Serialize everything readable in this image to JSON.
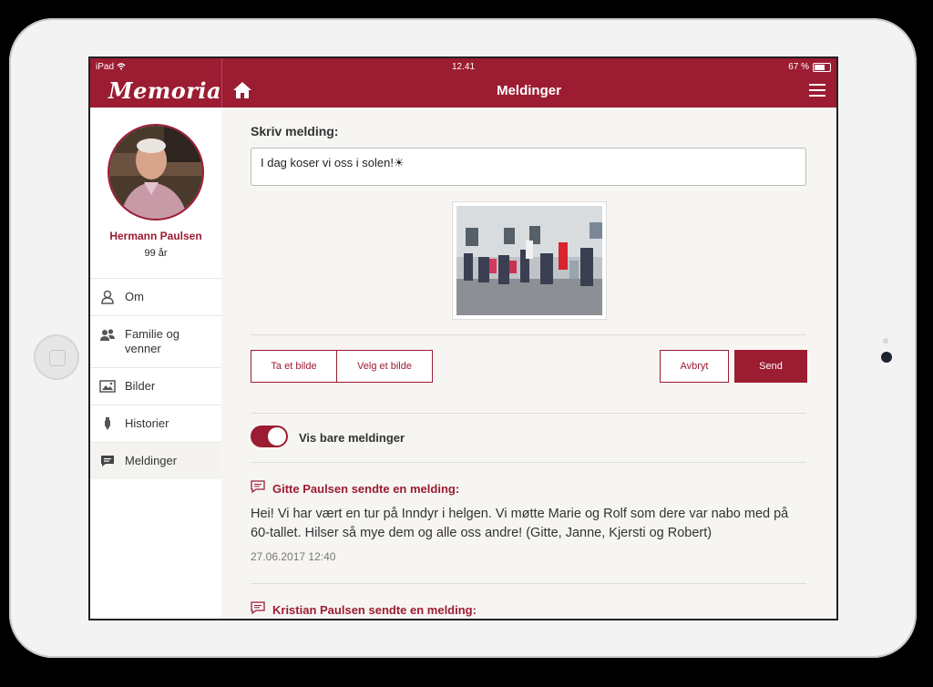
{
  "status": {
    "device": "iPad",
    "time": "12.41",
    "battery": "67 %"
  },
  "app": {
    "logo": "Memoria",
    "title": "Meldinger"
  },
  "profile": {
    "name": "Hermann Paulsen",
    "age": "99 år"
  },
  "nav": [
    {
      "label": "Om",
      "icon": "person-icon"
    },
    {
      "label": "Familie og venner",
      "icon": "people-icon"
    },
    {
      "label": "Bilder",
      "icon": "images-icon"
    },
    {
      "label": "Historier",
      "icon": "pen-icon"
    },
    {
      "label": "Meldinger",
      "icon": "chat-icon"
    }
  ],
  "compose": {
    "label": "Skriv melding:",
    "value": "I dag koser vi oss i solen!☀"
  },
  "buttons": {
    "take_photo": "Ta et bilde",
    "choose_photo": "Velg et bilde",
    "cancel": "Avbryt",
    "send": "Send"
  },
  "toggle": {
    "label": "Vis bare meldinger",
    "on": true
  },
  "messages": [
    {
      "title": "Gitte Paulsen sendte en melding:",
      "body": "Hei! Vi har vært en tur på Inndyr i helgen. Vi møtte Marie og Rolf som dere var nabo med på 60-tallet. Hilser så mye dem og alle oss andre! (Gitte, Janne, Kjersti og Robert)",
      "time": "27.06.2017 12:40"
    },
    {
      "title": "Kristian Paulsen sendte en melding:",
      "body": "",
      "time": ""
    }
  ],
  "colors": {
    "brand": "#9c1c32",
    "background": "#f7f5f2"
  }
}
